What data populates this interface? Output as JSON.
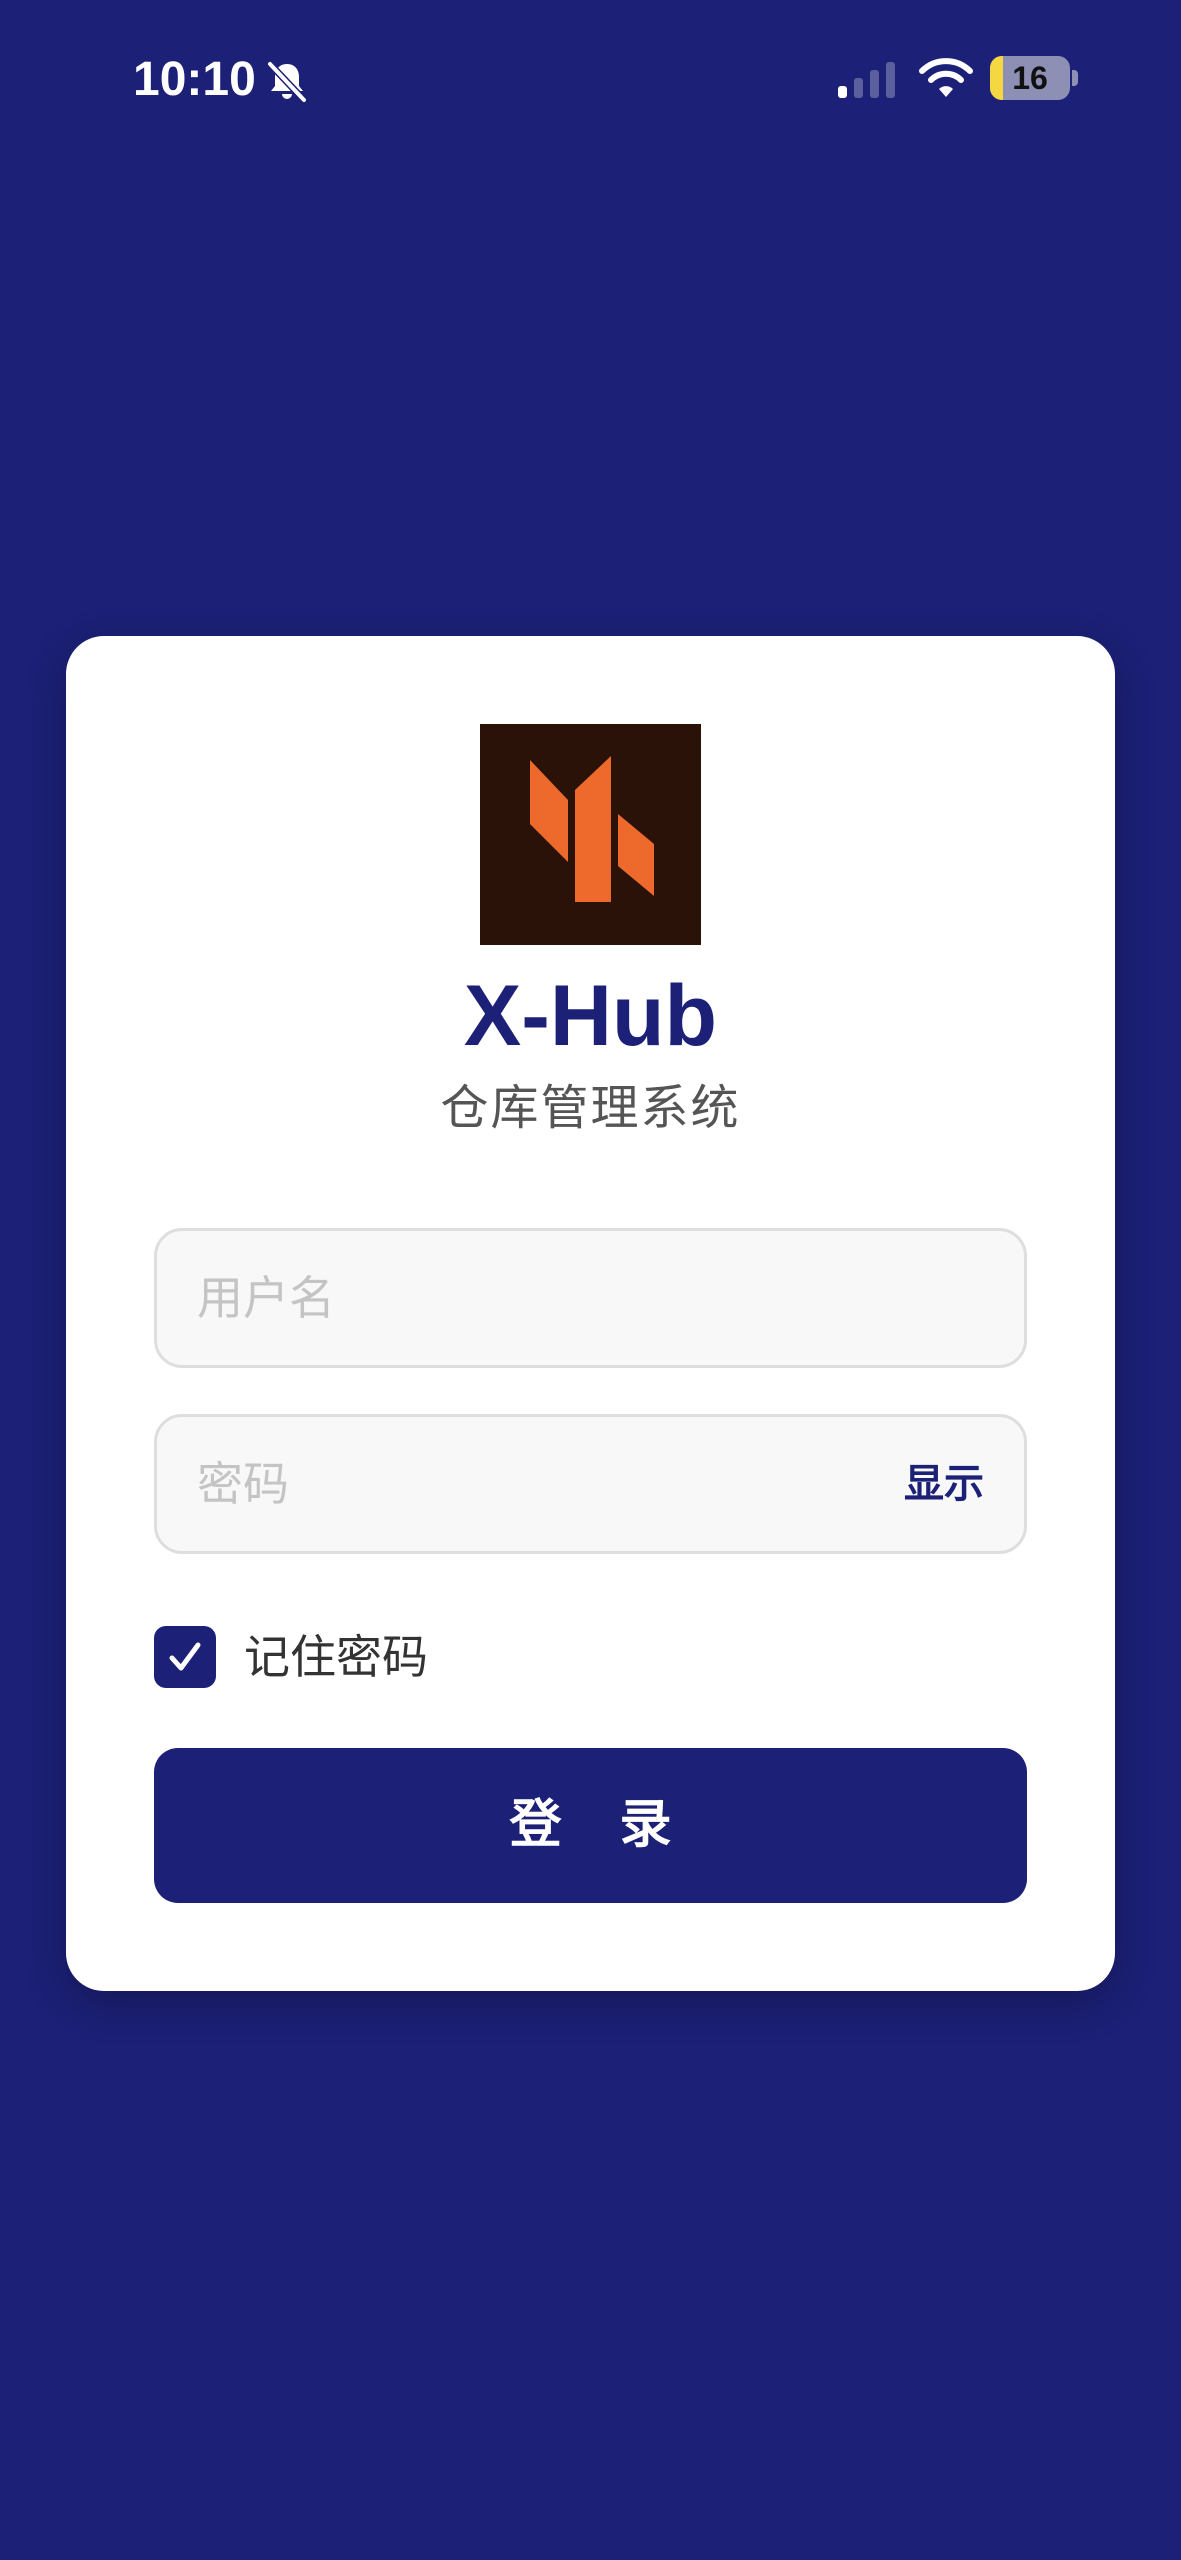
{
  "status_bar": {
    "time": "10:10",
    "battery_level": "16",
    "battery_fraction": 0.16,
    "bell_icon": "bell-slash-icon",
    "signal_icon": "cellular-signal-icon",
    "wifi_icon": "wifi-icon"
  },
  "login": {
    "logo_icon": "x-hub-logo",
    "app_name": "X-Hub",
    "subtitle": "仓库管理系统",
    "username": {
      "value": "",
      "placeholder": "用户名"
    },
    "password": {
      "value": "",
      "placeholder": "密码",
      "toggle_label": "显示"
    },
    "remember": {
      "label": "记住密码",
      "checked": true
    },
    "submit_label": "登 录"
  },
  "colors": {
    "background": "#1c2076",
    "card": "#ffffff",
    "accent": "#1c2076",
    "logo_background": "#2a1208",
    "logo_shapes": "#ee6a2c",
    "battery_fill": "#f5d742"
  }
}
